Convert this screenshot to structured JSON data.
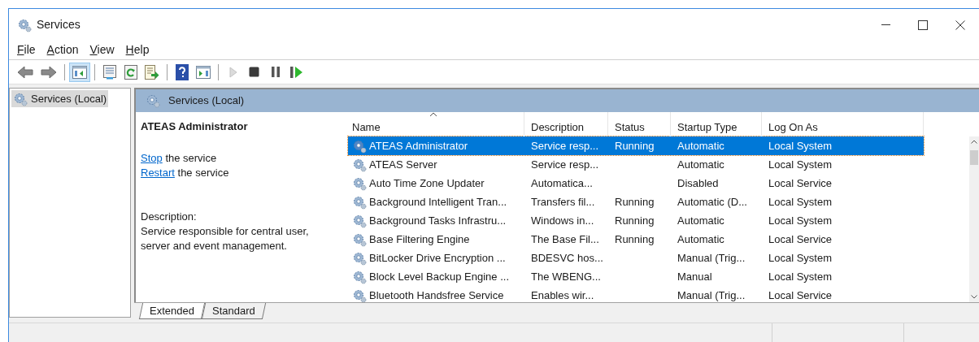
{
  "window": {
    "title": "Services"
  },
  "menu": [
    {
      "label": "File"
    },
    {
      "label": "Action"
    },
    {
      "label": "View"
    },
    {
      "label": "Help"
    }
  ],
  "toolbar": [
    {
      "kind": "back",
      "disabled": false,
      "pressed": false
    },
    {
      "kind": "forward",
      "disabled": false,
      "pressed": false
    },
    {
      "kind": "sep"
    },
    {
      "kind": "tree",
      "disabled": false,
      "pressed": true
    },
    {
      "kind": "sep"
    },
    {
      "kind": "properties",
      "disabled": false,
      "pressed": false
    },
    {
      "kind": "refresh",
      "disabled": false,
      "pressed": false
    },
    {
      "kind": "export",
      "disabled": false,
      "pressed": false
    },
    {
      "kind": "sep"
    },
    {
      "kind": "help",
      "disabled": false,
      "pressed": false
    },
    {
      "kind": "actionpane",
      "disabled": false,
      "pressed": false
    },
    {
      "kind": "sep"
    },
    {
      "kind": "play",
      "disabled": true,
      "pressed": false
    },
    {
      "kind": "stop",
      "disabled": false,
      "pressed": false
    },
    {
      "kind": "pause",
      "disabled": false,
      "pressed": false
    },
    {
      "kind": "resume",
      "disabled": false,
      "pressed": false
    }
  ],
  "tree": {
    "items": [
      {
        "label": "Services (Local)",
        "selected": true
      }
    ]
  },
  "pane_header": {
    "title": "Services (Local)"
  },
  "details": {
    "title": "ATEAS Administrator",
    "actions": [
      {
        "link": "Stop",
        "text": "the service"
      },
      {
        "link": "Restart",
        "text": "the service"
      }
    ],
    "description_label": "Description:",
    "description": "Service responsible for central user, server and event management."
  },
  "table": {
    "columns": [
      {
        "label": "Name",
        "sorted": true
      },
      {
        "label": "Description",
        "sorted": false
      },
      {
        "label": "Status",
        "sorted": false
      },
      {
        "label": "Startup Type",
        "sorted": false
      },
      {
        "label": "Log On As",
        "sorted": false
      }
    ],
    "rows": [
      {
        "cells": [
          "ATEAS Administrator",
          "Service resp...",
          "Running",
          "Automatic",
          "Local System"
        ],
        "selected": true
      },
      {
        "cells": [
          "ATEAS Server",
          "Service resp...",
          "",
          "Automatic",
          "Local System"
        ],
        "selected": false
      },
      {
        "cells": [
          "Auto Time Zone Updater",
          "Automatica...",
          "",
          "Disabled",
          "Local Service"
        ],
        "selected": false
      },
      {
        "cells": [
          "Background Intelligent Tran...",
          "Transfers fil...",
          "Running",
          "Automatic (D...",
          "Local System"
        ],
        "selected": false
      },
      {
        "cells": [
          "Background Tasks Infrastru...",
          "Windows in...",
          "Running",
          "Automatic",
          "Local System"
        ],
        "selected": false
      },
      {
        "cells": [
          "Base Filtering Engine",
          "The Base Fil...",
          "Running",
          "Automatic",
          "Local Service"
        ],
        "selected": false
      },
      {
        "cells": [
          "BitLocker Drive Encryption ...",
          "BDESVC hos...",
          "",
          "Manual (Trig...",
          "Local System"
        ],
        "selected": false
      },
      {
        "cells": [
          "Block Level Backup Engine ...",
          "The WBENG...",
          "",
          "Manual",
          "Local System"
        ],
        "selected": false
      },
      {
        "cells": [
          "Bluetooth Handsfree Service",
          "Enables wir...",
          "",
          "Manual (Trig...",
          "Local Service"
        ],
        "selected": false
      }
    ]
  },
  "tabs": [
    {
      "label": "Extended",
      "selected": true
    },
    {
      "label": "Standard",
      "selected": false
    }
  ]
}
